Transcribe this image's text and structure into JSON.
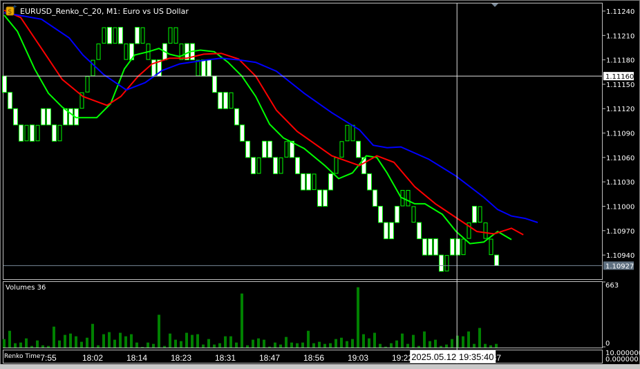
{
  "window": {
    "title": "EURUSD_Renko_C_20, M1:  Euro vs US Dollar",
    "colors": {
      "background": "#000000",
      "frame": "#c0c0c0",
      "bull_outline": "#00ff00",
      "bear_fill": "#ffffff",
      "ma_fast": "#00ff00",
      "ma_mid": "#ff0000",
      "ma_slow": "#0000ff",
      "volume": "#008000",
      "current_price_label": "#5f7080"
    }
  },
  "price_axis": {
    "ticks": [
      "1.11240",
      "1.11210",
      "1.11180",
      "1.11150",
      "1.11120",
      "1.11090",
      "1.11060",
      "1.11030",
      "1.11000",
      "1.10970",
      "1.10940"
    ],
    "crosshair_label": "1.11160",
    "current_price_label": "1.10927"
  },
  "volume_pane": {
    "label": "Volumes 36",
    "max_label": "663",
    "min_label": "0"
  },
  "renko_time_pane": {
    "label": "Renko Time",
    "max_label": "10.000000",
    "min_label": "0.000000"
  },
  "time_axis": {
    "labels": [
      {
        "text": "7:55",
        "index": 8
      },
      {
        "text": "18:02",
        "index": 16
      },
      {
        "text": "18:14",
        "index": 24
      },
      {
        "text": "18:23",
        "index": 32
      },
      {
        "text": "18:31",
        "index": 40
      },
      {
        "text": "18:47",
        "index": 48
      },
      {
        "text": "18:56",
        "index": 56
      },
      {
        "text": "19:03",
        "index": 64
      },
      {
        "text": "19:22",
        "index": 72
      },
      {
        "text": "19:37",
        "index": 88
      }
    ],
    "crosshair_label": "2025.05.12 19:35:40"
  },
  "chart_data": {
    "type": "renko",
    "symbol": "EURUSD",
    "brick_size": 0.0002,
    "base_level_price": 1.1122,
    "crosshair": {
      "price": 1.1116,
      "index": 81.9
    },
    "current_price": 1.10927,
    "bricks_level": [
      3,
      4,
      5,
      6,
      6,
      6,
      6,
      5,
      5,
      6,
      6,
      5,
      5,
      5,
      4,
      3,
      2,
      1,
      0,
      0,
      0,
      0,
      1,
      1,
      0,
      0,
      1,
      2,
      2,
      1,
      0,
      0,
      1,
      1,
      1,
      2,
      2,
      2,
      3,
      4,
      4,
      4,
      5,
      6,
      7,
      8,
      8,
      7,
      7,
      8,
      8,
      7,
      7,
      8,
      9,
      9,
      9,
      10,
      10,
      9,
      8,
      7,
      6,
      6,
      7,
      8,
      9,
      10,
      11,
      12,
      12,
      11,
      10,
      10,
      11,
      12,
      13,
      13,
      13,
      14,
      14,
      13,
      13,
      13,
      12,
      11,
      11,
      12,
      13,
      14
    ],
    "bricks_dir": "ddddududdduddduuuuudududduuddduuuddudddddudddduddduudddduddduuuudddddddduuudddddudduuduuudddd",
    "volumes": [
      90,
      177,
      46,
      53,
      97,
      17,
      75,
      24,
      17,
      221,
      75,
      134,
      148,
      119,
      61,
      104,
      250,
      24,
      141,
      163,
      83,
      156,
      119,
      141,
      53,
      7,
      53,
      39,
      346,
      17,
      148,
      83,
      68,
      156,
      134,
      141,
      32,
      90,
      32,
      46,
      119,
      119,
      53,
      570,
      24,
      83,
      97,
      83,
      10,
      53,
      32,
      112,
      53,
      46,
      53,
      177,
      46,
      61,
      39,
      46,
      90,
      104,
      68,
      90,
      636,
      141,
      97,
      156,
      39,
      10,
      46,
      75,
      148,
      39,
      134,
      17,
      170,
      68,
      83,
      17,
      32,
      90,
      126,
      119,
      170,
      39,
      207,
      39,
      24,
      39
    ],
    "volume_max": 663,
    "ma_series": [
      {
        "name": "fast",
        "color": "#00ff00",
        "points": [
          [
            0,
            1.11235
          ],
          [
            2.4,
            1.11215
          ],
          [
            5.5,
            1.11169
          ],
          [
            8,
            1.11139
          ],
          [
            10.5,
            1.11122
          ],
          [
            13,
            1.11109
          ],
          [
            16.75,
            1.11109
          ],
          [
            19.25,
            1.11126
          ],
          [
            21.75,
            1.11169
          ],
          [
            23.6,
            1.11186
          ],
          [
            26.1,
            1.1119
          ],
          [
            28,
            1.11194
          ],
          [
            29.9,
            1.11187
          ],
          [
            31.75,
            1.11184
          ],
          [
            33.6,
            1.1119
          ],
          [
            35.5,
            1.11192
          ],
          [
            38,
            1.1119
          ],
          [
            40.5,
            1.11177
          ],
          [
            43,
            1.1116
          ],
          [
            45.5,
            1.11135
          ],
          [
            48,
            1.11101
          ],
          [
            50.5,
            1.11084
          ],
          [
            54.25,
            1.11071
          ],
          [
            58,
            1.1105
          ],
          [
            60.5,
            1.11034
          ],
          [
            63,
            1.11041
          ],
          [
            65.5,
            1.11062
          ],
          [
            67.4,
            1.1106
          ],
          [
            69.25,
            1.11041
          ],
          [
            71.75,
            1.11011
          ],
          [
            74.25,
            1.11003
          ],
          [
            76.1,
            1.11003
          ],
          [
            79.25,
            1.1099
          ],
          [
            81.75,
            1.10969
          ],
          [
            84.25,
            1.10954
          ],
          [
            86.75,
            1.10956
          ],
          [
            89.25,
            1.10969
          ],
          [
            91.75,
            1.10959
          ]
        ]
      },
      {
        "name": "mid",
        "color": "#ff0000",
        "points": [
          [
            0,
            1.11241
          ],
          [
            3,
            1.11232
          ],
          [
            6.75,
            1.11194
          ],
          [
            10.5,
            1.11156
          ],
          [
            14.25,
            1.11135
          ],
          [
            18.6,
            1.11124
          ],
          [
            21.1,
            1.11135
          ],
          [
            24.25,
            1.1116
          ],
          [
            26.75,
            1.11175
          ],
          [
            29.9,
            1.11182
          ],
          [
            33,
            1.11182
          ],
          [
            36.1,
            1.11187
          ],
          [
            39.25,
            1.11188
          ],
          [
            42.4,
            1.11181
          ],
          [
            45.5,
            1.1116
          ],
          [
            49.25,
            1.11118
          ],
          [
            53,
            1.11092
          ],
          [
            59.25,
            1.11062
          ],
          [
            64.25,
            1.1105
          ],
          [
            67.4,
            1.11062
          ],
          [
            70.5,
            1.11054
          ],
          [
            74.25,
            1.11024
          ],
          [
            78,
            1.11003
          ],
          [
            81.75,
            1.10986
          ],
          [
            85.5,
            1.10969
          ],
          [
            88.6,
            1.10966
          ],
          [
            91.75,
            1.10973
          ],
          [
            93.9,
            1.10965
          ]
        ]
      },
      {
        "name": "slow",
        "color": "#0000ff",
        "points": [
          [
            0,
            1.11238
          ],
          [
            6.75,
            1.1123
          ],
          [
            11.75,
            1.11207
          ],
          [
            14.25,
            1.11186
          ],
          [
            18,
            1.11162
          ],
          [
            22.1,
            1.11143
          ],
          [
            25.5,
            1.11152
          ],
          [
            28.6,
            1.11167
          ],
          [
            31.75,
            1.11175
          ],
          [
            36.75,
            1.1118
          ],
          [
            39.25,
            1.11182
          ],
          [
            42.4,
            1.1118
          ],
          [
            45.5,
            1.11177
          ],
          [
            49.25,
            1.11166
          ],
          [
            54.25,
            1.11139
          ],
          [
            59.25,
            1.11115
          ],
          [
            64.25,
            1.11094
          ],
          [
            66.75,
            1.11075
          ],
          [
            69.25,
            1.11072
          ],
          [
            71.75,
            1.11073
          ],
          [
            76.75,
            1.11058
          ],
          [
            81.75,
            1.11037
          ],
          [
            86.75,
            1.11011
          ],
          [
            89.25,
            1.10996
          ],
          [
            91.75,
            1.10988
          ],
          [
            94.25,
            1.10985
          ],
          [
            96.5,
            1.1098
          ]
        ]
      }
    ]
  }
}
